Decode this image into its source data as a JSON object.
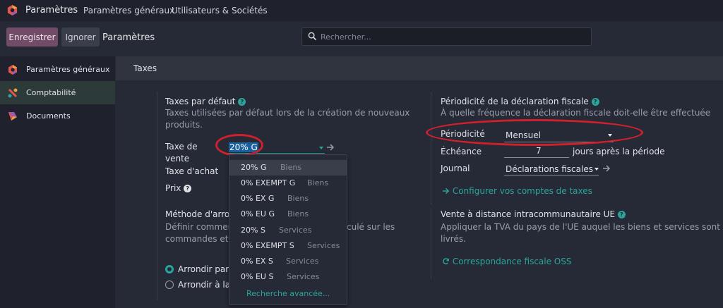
{
  "topbar": {
    "app_title": "Paramètres",
    "menu": [
      "Paramètres généraux",
      "Utilisateurs & Sociétés"
    ]
  },
  "control": {
    "save_label": "Enregistrer",
    "ignore_label": "Ignorer",
    "title": "Paramètres",
    "search_placeholder": "Rechercher..."
  },
  "sidebar": {
    "items": [
      {
        "label": "Paramètres généraux",
        "icon": "odoo-logo-icon"
      },
      {
        "label": "Comptabilité",
        "icon": "accounting-icon"
      },
      {
        "label": "Documents",
        "icon": "documents-icon"
      }
    ]
  },
  "section": {
    "title": "Taxes"
  },
  "default_taxes": {
    "title": "Taxes par défaut",
    "desc_line1": "Taxes utilisées par défaut lors de la création de nouveaux",
    "desc_line2": "produits.",
    "sale_label_line1": "Taxe de",
    "sale_label_line2": "vente",
    "sale_value": "20% G",
    "purchase_label": "Taxe d'achat",
    "price_label": "Prix"
  },
  "rounding": {
    "title_visible": "Méthode d'arrond",
    "desc_left1": "Définir comment",
    "desc_right1": "culé sur les",
    "desc_left2": "commandes et fac",
    "option1": "Arrondir par ta",
    "option2": "Arrondir à la li"
  },
  "tax_dropdown": {
    "items": [
      {
        "code": "20% G",
        "scope": "Biens"
      },
      {
        "code": "0% EXEMPT G",
        "scope": "Biens"
      },
      {
        "code": "0% EX G",
        "scope": "Biens"
      },
      {
        "code": "0% EU G",
        "scope": "Biens"
      },
      {
        "code": "20% S",
        "scope": "Services"
      },
      {
        "code": "0% EXEMPT S",
        "scope": "Services"
      },
      {
        "code": "0% EX S",
        "scope": "Services"
      },
      {
        "code": "0% EU S",
        "scope": "Services"
      }
    ],
    "advanced": "Recherche avancée..."
  },
  "periodicity": {
    "title": "Périodicité de la déclaration fiscale",
    "desc": "À quelle fréquence la déclaration fiscale doit-elle être effectuée",
    "period_label": "Périodicité",
    "period_value": "Mensuel",
    "due_label": "Échéance",
    "due_value": "7",
    "due_suffix": "jours après la période",
    "journal_label": "Journal",
    "journal_value": "Déclarations fiscales",
    "configure_link": "Configurer vos comptes de taxes"
  },
  "distance_sales": {
    "title": "Vente à distance intracommunautaire UE",
    "desc_line1": "Appliquer la TVA du pays de l'UE auquel les biens et services sont",
    "desc_line2": "livrés.",
    "link": "Correspondance fiscale OSS"
  },
  "colors": {
    "accent": "#2ba49a",
    "primary_button": "#714b67",
    "annotation": "#d0202c"
  }
}
